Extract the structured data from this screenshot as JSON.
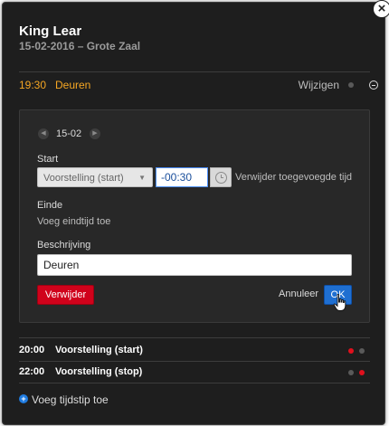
{
  "header": {
    "title": "King Lear",
    "subtitle": "15-02-2016 – Grote Zaal"
  },
  "selected_item": {
    "time": "19:30",
    "label": "Deuren",
    "edit_label": "Wijzigen"
  },
  "editor": {
    "date": "15-02",
    "start_label": "Start",
    "start_reference": "Voorstelling (start)",
    "start_offset": "-00:30",
    "remove_added_time": "Verwijder toegevoegde tijd",
    "end_label": "Einde",
    "add_end_time": "Voeg eindtijd toe",
    "description_label": "Beschrijving",
    "description_value": "Deuren",
    "delete_label": "Verwijder",
    "cancel_label": "Annuleer",
    "ok_label": "OK"
  },
  "schedule": [
    {
      "time": "20:00",
      "label": "Voorstelling (start)"
    },
    {
      "time": "22:00",
      "label": "Voorstelling (stop)"
    }
  ],
  "footer": {
    "add_time_label": "Voeg tijdstip toe"
  },
  "colors": {
    "accent_orange": "#f5a623",
    "status_red": "#e0101d",
    "status_grey": "#5a5a5a",
    "primary_blue": "#1f6fd1",
    "danger_red": "#d0021b"
  },
  "icons": [
    "close-icon",
    "minus-circle-icon",
    "chevron-left-icon",
    "chevron-right-icon",
    "clock-icon",
    "caret-down-icon",
    "plus-circle-icon",
    "hand-cursor-icon"
  ]
}
